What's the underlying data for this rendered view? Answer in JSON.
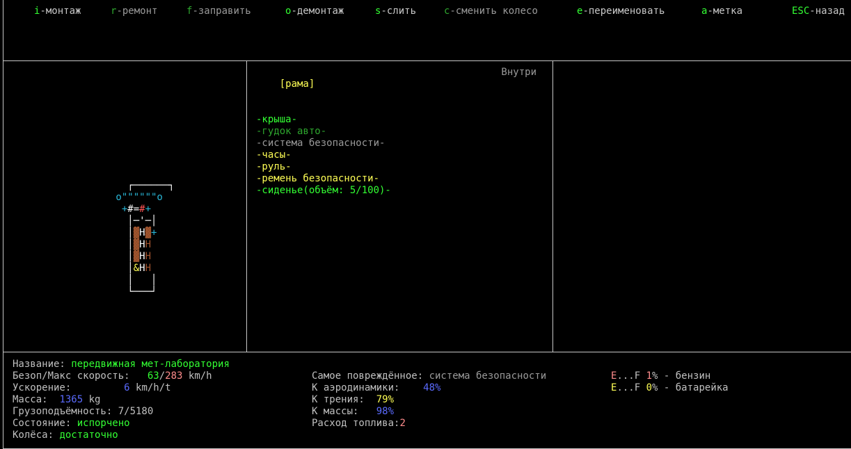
{
  "menu": [
    {
      "key": "i",
      "label": "-монтаж",
      "enabled": true
    },
    {
      "key": "r",
      "label": "-ремонт",
      "enabled": false
    },
    {
      "key": "f",
      "label": "-заправить",
      "enabled": false
    },
    {
      "key": "o",
      "label": "-демонтаж",
      "enabled": true
    },
    {
      "key": "s",
      "label": "-слить",
      "enabled": true
    },
    {
      "key": "c",
      "label": "-сменить колесо",
      "enabled": false
    },
    {
      "key": "e",
      "label": "-переименовать",
      "enabled": true
    },
    {
      "key": "a",
      "label": "-метка",
      "enabled": true
    },
    {
      "key": "ESC",
      "label": "-назад",
      "enabled": true
    }
  ],
  "parts": {
    "frame_label": "[рама]",
    "location": "Внутри",
    "items": [
      {
        "text": "-крыша-",
        "color": "green"
      },
      {
        "text": "-гудок авто-",
        "color": "darkgreen"
      },
      {
        "text": "-система безопасности-",
        "color": "gray"
      },
      {
        "text": "-часы-",
        "color": "yellow"
      },
      {
        "text": "-руль-",
        "color": "yellow"
      },
      {
        "text": "-ремень безопасности-",
        "color": "yellow"
      },
      {
        "text": "-сиденье(объём: 5/100)-",
        "color": "green"
      }
    ]
  },
  "stats": {
    "name_label": "Название: ",
    "name_value": "передвижная мет-лаборатория",
    "speed_label": "Безоп/Макс скорость: ",
    "speed_safe": "63",
    "speed_sep": "/",
    "speed_max": "283",
    "speed_unit": " km/h",
    "accel_label": "Ускорение:",
    "accel_value": "6",
    "accel_unit": " km/h/t",
    "mass_label": "Масса:",
    "mass_value": "1365",
    "mass_unit": " kg",
    "capacity_label": "Грузоподъёмность: ",
    "capacity_value": "7/5180",
    "state_label": "Состояние: ",
    "state_value": "испорчено",
    "wheels_label": "Колёса: ",
    "wheels_value": "достаточно",
    "damaged_label": "Самое повреждённое: ",
    "damaged_value": "система безопасности",
    "aero_label": "К аэродинамики:",
    "aero_value": "48%",
    "friction_label": "К трения:",
    "friction_value": "79%",
    "massk_label": "К массы:",
    "massk_value": "98%",
    "fuel_label": "Расход топлива:",
    "fuel_value": "2",
    "fuel_gauge_e": "E",
    "fuel_gauge_f": "...F",
    "fuel_pct": "1",
    "fuel_rest": "% - бензин",
    "bat_gauge_e": "E",
    "bat_gauge_f": "...F",
    "bat_pct": "0",
    "bat_rest": "% - батарейка"
  },
  "vehicle_rows": [
    " ┌─────┐ ",
    "o\"\"\"\"\"\"o",
    " +#=#+  ",
    "  │_'_│ ",
    "  │HH│+ ",
    "  │HH│  ",
    "  │HH│  ",
    "  │&HH│ ",
    "  │  │  ",
    "  └──┘  "
  ]
}
